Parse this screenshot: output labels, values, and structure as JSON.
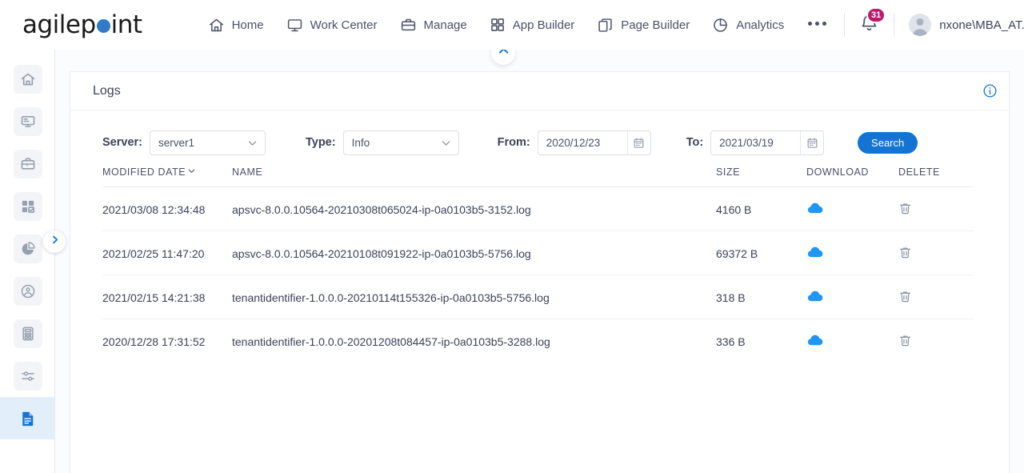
{
  "brand": {
    "name_part1": "agilep",
    "name_part2": "int",
    "dot_color": "#2f7ac9"
  },
  "topnav": {
    "items": [
      {
        "label": "Home",
        "icon": "home-icon"
      },
      {
        "label": "Work Center",
        "icon": "monitor-icon"
      },
      {
        "label": "Manage",
        "icon": "briefcase-icon"
      },
      {
        "label": "App Builder",
        "icon": "grid-icon"
      },
      {
        "label": "Page Builder",
        "icon": "copy-icon"
      },
      {
        "label": "Analytics",
        "icon": "pie-chart-icon"
      }
    ],
    "more_label": "More options",
    "notifications": {
      "count": "31",
      "badge_color": "#c2186c"
    },
    "user": {
      "name": "nxone\\MBA_AT..."
    }
  },
  "sidebar": {
    "items": [
      {
        "name": "home",
        "icon": "home-icon",
        "active": false
      },
      {
        "name": "work-center",
        "icon": "monitor-icon",
        "active": false
      },
      {
        "name": "manage",
        "icon": "briefcase-icon",
        "active": false
      },
      {
        "name": "app-builder",
        "icon": "grid-check-icon",
        "active": false
      },
      {
        "name": "analytics",
        "icon": "pie-chart-icon",
        "active": false
      },
      {
        "name": "users",
        "icon": "person-gear-icon",
        "active": false
      },
      {
        "name": "calculator",
        "icon": "calculator-icon",
        "active": false
      },
      {
        "name": "settings",
        "icon": "sliders-icon",
        "active": false
      },
      {
        "name": "logs",
        "icon": "document-icon",
        "active": true
      }
    ],
    "expand_tooltip": "Expand"
  },
  "card": {
    "title": "Logs",
    "info_tooltip": "Information"
  },
  "filters": {
    "server": {
      "label": "Server:",
      "value": "server1"
    },
    "type": {
      "label": "Type:",
      "value": "Info"
    },
    "from": {
      "label": "From:",
      "value": "2020/12/23",
      "placeholder": "yyyy/mm/dd"
    },
    "to": {
      "label": "To:",
      "value": "2021/03/19",
      "placeholder": "yyyy/mm/dd"
    },
    "search_label": "Search",
    "search_color": "#1474d4"
  },
  "table": {
    "columns": [
      {
        "key": "modified_date",
        "label": "MODIFIED DATE",
        "sorted": true,
        "sort_dir": "desc"
      },
      {
        "key": "name",
        "label": "NAME"
      },
      {
        "key": "size",
        "label": "SIZE"
      },
      {
        "key": "download",
        "label": "DOWNLOAD"
      },
      {
        "key": "delete",
        "label": "DELETE"
      }
    ],
    "rows": [
      {
        "modified_date": "2021/03/08 12:34:48",
        "name": "apsvc-8.0.0.10564-20210308t065024-ip-0a0103b5-3152.log",
        "size": "4160 B"
      },
      {
        "modified_date": "2021/02/25 11:47:20",
        "name": "apsvc-8.0.0.10564-20210108t091922-ip-0a0103b5-5756.log",
        "size": "69372 B"
      },
      {
        "modified_date": "2021/02/15 14:21:38",
        "name": "tenantidentifier-1.0.0.0-20210114t155326-ip-0a0103b5-5756.log",
        "size": "318 B"
      },
      {
        "modified_date": "2020/12/28 17:31:52",
        "name": "tenantidentifier-1.0.0.0-20201208t084457-ip-0a0103b5-3288.log",
        "size": "336 B"
      }
    ],
    "download_icon": "cloud-download-icon",
    "delete_icon": "trash-icon",
    "download_color": "#2196f3"
  }
}
